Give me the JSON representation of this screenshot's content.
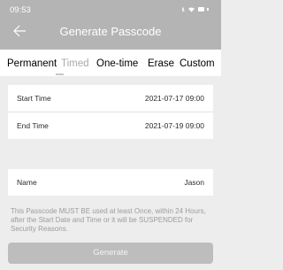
{
  "status_bar": {
    "time": "09:53",
    "signal": "ıı."
  },
  "header": {
    "title": "Generate Passcode"
  },
  "tabs": [
    {
      "label": "Permanent",
      "active": false
    },
    {
      "label": "Timed",
      "active": true
    },
    {
      "label": "One-time",
      "active": false
    },
    {
      "label": "Erase",
      "active": false
    },
    {
      "label": "Custom",
      "active": false
    }
  ],
  "form": {
    "start_time_label": "Start Time",
    "start_time_value": "2021-07-17 09:00",
    "end_time_label": "End Time",
    "end_time_value": "2021-07-19 09:00",
    "name_label": "Name",
    "name_value": "Jason"
  },
  "notice": "This Passcode MUST BE used at least Once, within 24 Hours, after the Start Date and Time or it will be SUSPENDED for Security Reasons.",
  "generate_label": "Generate",
  "colors": {
    "header_bg": "#b4b4b4",
    "page_bg": "#ededed",
    "button_bg": "#bdbdbd"
  }
}
